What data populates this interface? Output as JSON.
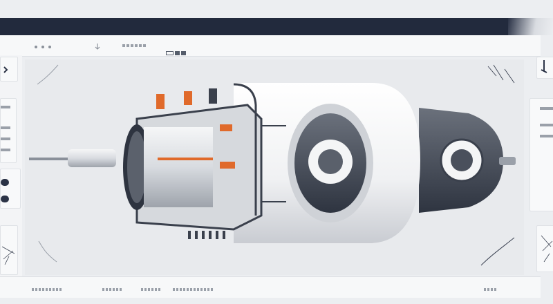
{
  "window": {
    "topbar_color": "#222a3d",
    "accent_color": "#e06a2b"
  },
  "toolbar": {
    "icons": [
      "window-dot-icon",
      "window-dot-icon",
      "window-dot-icon",
      "arrow-icon",
      "squares-icon"
    ]
  },
  "left_sidebar": {
    "icons": [
      "chevron-icon",
      "menu-bar-icon",
      "toggle-icon",
      "sketch-icon"
    ]
  },
  "right_sidebar": {
    "icons": [
      "pin-icon",
      "menu-bar-icon",
      "sketch-icon"
    ]
  },
  "canvas": {
    "illustration": "turbine-engine-illustration"
  }
}
